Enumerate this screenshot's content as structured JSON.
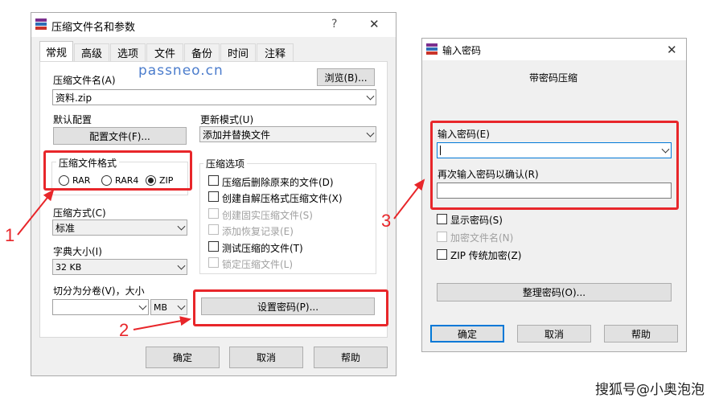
{
  "left_dialog": {
    "title": "压缩文件名和参数",
    "help_btn": "?",
    "close_btn": "✕",
    "tabs": [
      "常规",
      "高级",
      "选项",
      "文件",
      "备份",
      "时间",
      "注释"
    ],
    "watermark": "passneo.cn",
    "archive_name_label": "压缩文件名(A)",
    "browse_button": "浏览(B)...",
    "archive_name_value": "资料.zip",
    "default_config_label": "默认配置",
    "config_button": "配置文件(F)...",
    "update_mode_label": "更新模式(U)",
    "update_mode_value": "添加并替换文件",
    "format_group_title": "压缩文件格式",
    "formats": [
      "RAR",
      "RAR4",
      "ZIP"
    ],
    "selected_format": "ZIP",
    "options_group_title": "压缩选项",
    "options": [
      {
        "label": "压缩后删除原来的文件(D)",
        "enabled": true
      },
      {
        "label": "创建自解压格式压缩文件(X)",
        "enabled": true
      },
      {
        "label": "创建固实压缩文件(S)",
        "enabled": false
      },
      {
        "label": "添加恢复记录(E)",
        "enabled": false
      },
      {
        "label": "测试压缩的文件(T)",
        "enabled": true
      },
      {
        "label": "锁定压缩文件(L)",
        "enabled": false
      }
    ],
    "method_label": "压缩方式(C)",
    "method_value": "标准",
    "dict_label": "字典大小(I)",
    "dict_value": "32 KB",
    "split_label": "切分为分卷(V)，大小",
    "split_value": "",
    "split_unit": "MB",
    "set_password_button": "设置密码(P)...",
    "ok_button": "确定",
    "cancel_button": "取消",
    "help_button": "帮助"
  },
  "right_dialog": {
    "title": "输入密码",
    "close_btn": "✕",
    "subtitle": "带密码压缩",
    "password_label": "输入密码(E)",
    "password_value": "",
    "confirm_label": "再次输入密码以确认(R)",
    "confirm_value": "",
    "show_password": "显示密码(S)",
    "encrypt_filenames": "加密文件名(N)",
    "zip_legacy": "ZIP 传统加密(Z)",
    "organize_button": "整理密码(O)...",
    "ok_button": "确定",
    "cancel_button": "取消",
    "help_button": "帮助"
  },
  "annotations": {
    "n1": "1",
    "n2": "2",
    "n3": "3"
  },
  "credit": "搜狐号@小奥泡泡",
  "colors": {
    "accent_red": "#e8262a",
    "dialog_bg": "#f0f0f0",
    "focus_blue": "#0078d7"
  }
}
